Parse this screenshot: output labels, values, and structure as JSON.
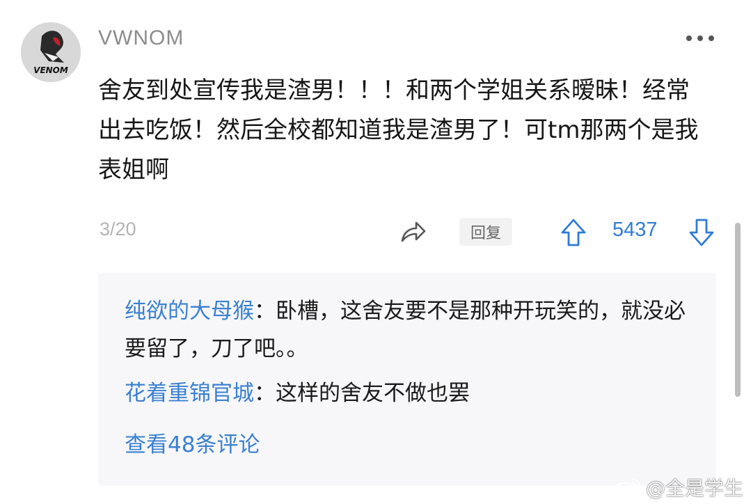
{
  "post": {
    "username": "VWNOM",
    "avatar_text": "VENOM",
    "text": "舍友到处宣传我是渣男！！！和两个学姐关系暧昧！经常出去吃饭！然后全校都知道我是渣男了！可tm那两个是我表姐啊",
    "index": "3/20",
    "reply_label": "回复",
    "votes": "5437"
  },
  "replies": [
    {
      "author": "纯欲的大母猴",
      "sep": "：",
      "text": "卧槽，这舍友要不是那种开玩笑的，就没必要留了，刀了吧。。"
    },
    {
      "author": "花着重锦官城",
      "sep": "：",
      "text": "这样的舍友不做也罢"
    }
  ],
  "view_all": "查看48条评论",
  "watermark": "@全是学生",
  "icons": {
    "more": "more-dots-icon",
    "share": "share-icon",
    "upvote": "upvote-arrow-icon",
    "downvote": "downvote-arrow-icon",
    "watermark": "weibo-logo-icon"
  },
  "colors": {
    "accent": "#3a80d2",
    "muted": "#8c8c8c",
    "panel": "#f7f7f9"
  }
}
